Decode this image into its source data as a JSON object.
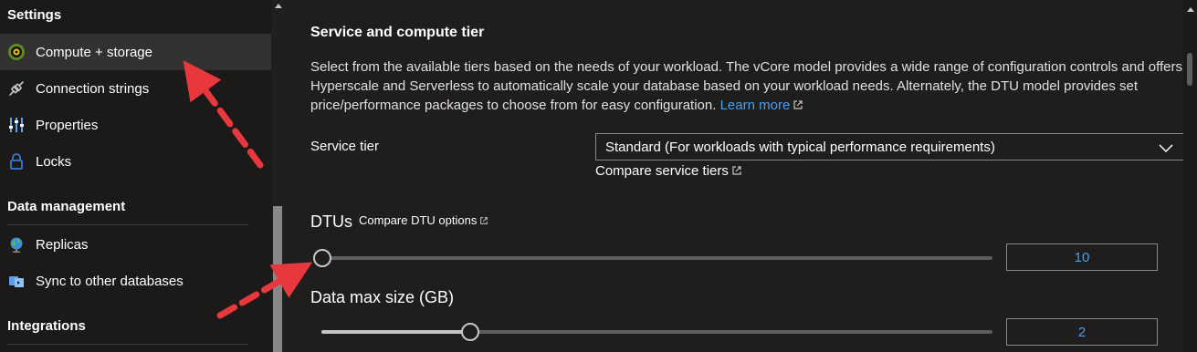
{
  "sidebar": {
    "sections": [
      {
        "header": "Settings",
        "items": [
          {
            "label": "Compute + storage",
            "icon": "compute-storage-icon",
            "selected": true
          },
          {
            "label": "Connection strings",
            "icon": "plug-icon"
          },
          {
            "label": "Properties",
            "icon": "properties-icon"
          },
          {
            "label": "Locks",
            "icon": "lock-icon"
          }
        ]
      },
      {
        "header": "Data management",
        "items": [
          {
            "label": "Replicas",
            "icon": "globe-icon"
          },
          {
            "label": "Sync to other databases",
            "icon": "sync-icon"
          }
        ]
      },
      {
        "header": "Integrations",
        "items": []
      }
    ]
  },
  "main": {
    "title": "Service and compute tier",
    "description": "Select from the available tiers based on the needs of your workload. The vCore model provides a wide range of configuration controls and offers Hyperscale and Serverless to automatically scale your database based on your workload needs. Alternately, the DTU model provides set price/performance packages to choose from for easy configuration.",
    "learn_more": "Learn more",
    "service_tier": {
      "label": "Service tier",
      "value": "Standard (For workloads with typical performance requirements)",
      "compare_link": "Compare service tiers"
    },
    "dtus": {
      "label": "DTUs",
      "compare_link": "Compare DTU options",
      "value": "10",
      "slider_fraction": 0
    },
    "data_max_size": {
      "label": "Data max size (GB)",
      "value": "2",
      "slider_fraction": 0.22
    }
  },
  "colors": {
    "link": "#479ef5",
    "annotation_arrow": "#e8383d",
    "background": "#1b1a19"
  }
}
